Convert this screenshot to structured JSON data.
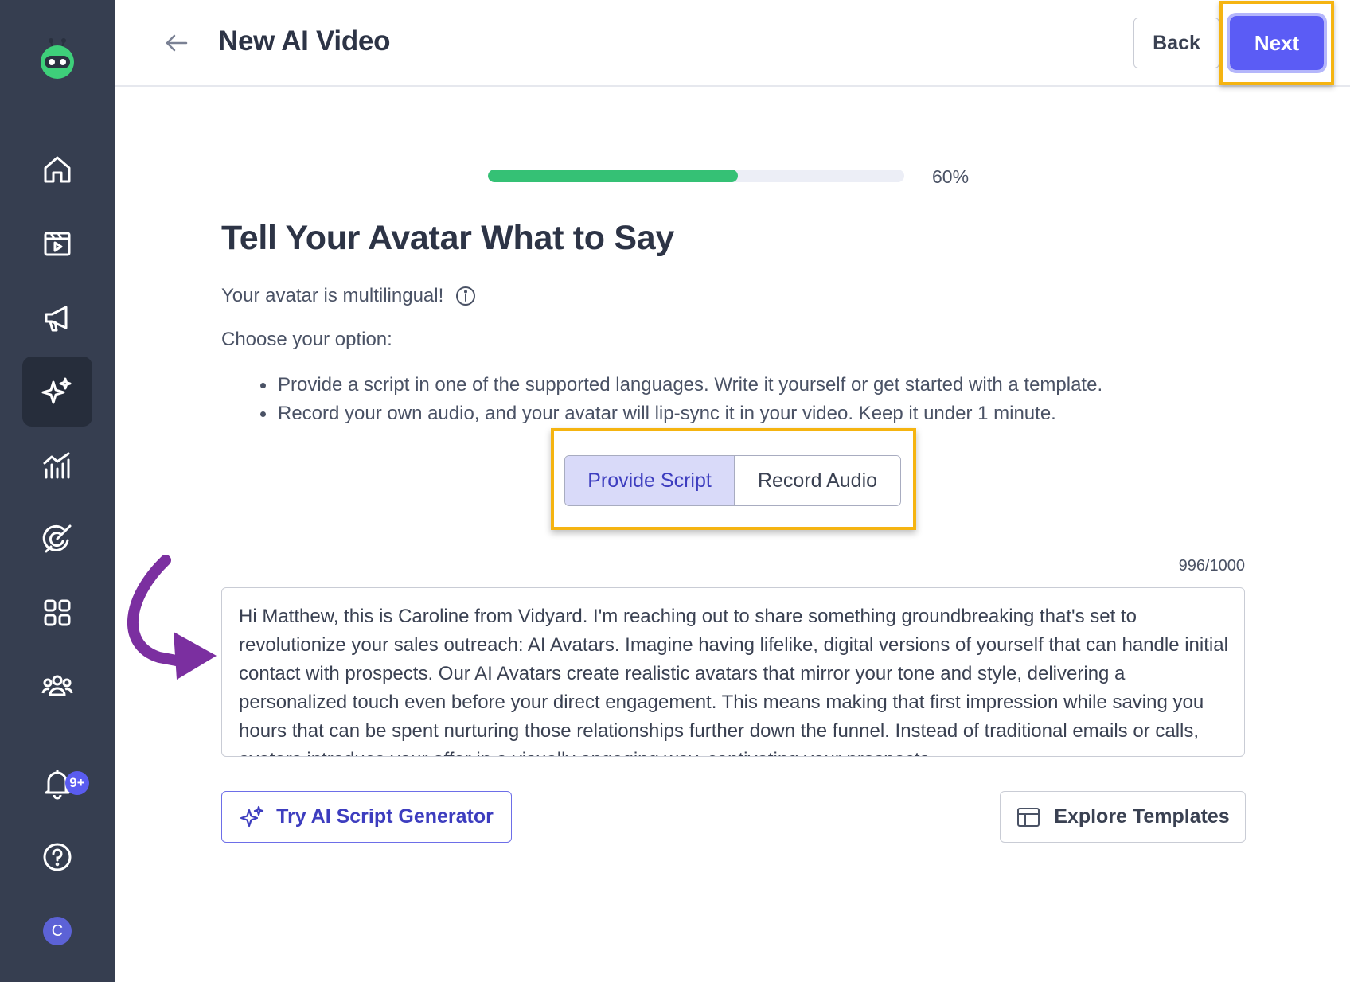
{
  "header": {
    "title": "New AI Video",
    "back_label": "Back",
    "next_label": "Next"
  },
  "sidebar": {
    "items": [
      {
        "icon": "home-icon"
      },
      {
        "icon": "video-library-icon"
      },
      {
        "icon": "megaphone-icon"
      },
      {
        "icon": "ai-sparkles-icon",
        "active": true
      },
      {
        "icon": "analytics-icon"
      },
      {
        "icon": "integrations-icon"
      },
      {
        "icon": "apps-grid-icon"
      },
      {
        "icon": "team-icon"
      },
      {
        "icon": "bell-icon"
      },
      {
        "icon": "help-icon"
      }
    ],
    "notification_badge": "9+",
    "avatar_initial": "C"
  },
  "progress": {
    "value": 0.6,
    "label": "60%"
  },
  "main": {
    "heading": "Tell Your Avatar What to Say",
    "multilingual_text": "Your avatar is multilingual!",
    "choose_text": "Choose your option:",
    "bullets": [
      "Provide a script in one of the supported languages. Write it yourself or get started with a template.",
      "Record your own audio, and your avatar will lip-sync it in your video. Keep it under 1 minute."
    ],
    "tabs": [
      {
        "label": "Provide Script",
        "selected": true
      },
      {
        "label": "Record Audio",
        "selected": false
      }
    ],
    "char_count": "996/1000",
    "script_text": "Hi Matthew, this is Caroline from Vidyard. I'm reaching out to share something groundbreaking that's set to revolutionize your sales outreach: AI Avatars. Imagine having lifelike, digital versions of yourself that can handle initial contact with prospects. Our AI Avatars create realistic avatars that mirror your tone and style, delivering a personalized touch even before your direct engagement. This means making that first impression while saving you hours that can be spent nurturing those relationships further down the funnel. Instead of traditional emails or calls, avatars introduce your offer in a visually engaging way, captivating your prospects",
    "ai_button_label": "Try AI Script Generator",
    "templates_button_label": "Explore Templates"
  },
  "colors": {
    "sidebar_bg": "#363e50",
    "accent": "#5b5cf5",
    "progress": "#35c175",
    "highlight": "#f5b411",
    "annotation_arrow": "#7b2fa0"
  }
}
